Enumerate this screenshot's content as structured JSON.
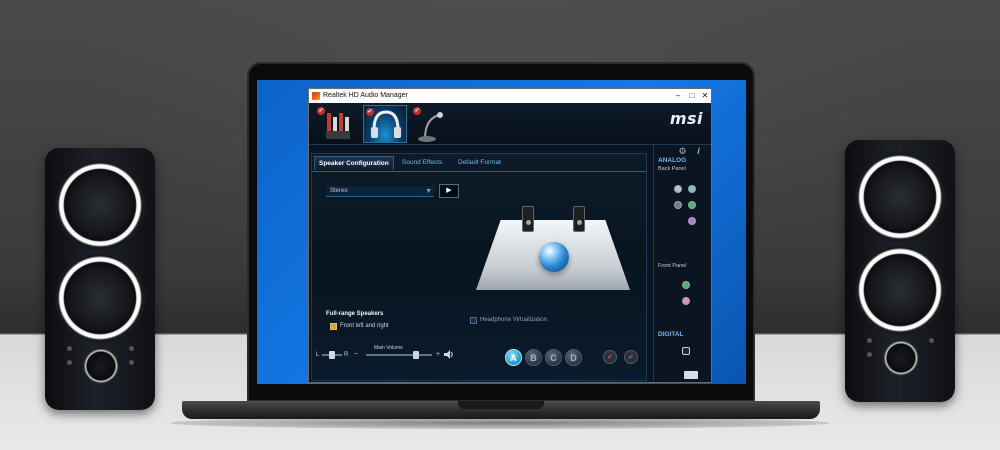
{
  "window": {
    "title": "Realtek HD Audio Manager",
    "minimize": "–",
    "maximize": "□",
    "close": "✕",
    "brand": "msi"
  },
  "tabs": [
    {
      "label": "Speaker Configuration",
      "active": true
    },
    {
      "label": "Sound Effects",
      "active": false
    },
    {
      "label": "Default Format",
      "active": false
    }
  ],
  "config": {
    "selected": "Stereo",
    "play_icon": "▶"
  },
  "fullrange": {
    "heading": "Full-range Speakers",
    "option": "Front left and right",
    "checked": true
  },
  "virtualization": {
    "label": "Headphone Virtualization",
    "checked": false
  },
  "volume": {
    "label": "Main Volume",
    "left": "L",
    "right": "R",
    "minus": "−",
    "plus": "+",
    "balance": 0.5,
    "level": 0.75
  },
  "profiles": [
    "A",
    "B",
    "C",
    "D"
  ],
  "side": {
    "analog": "ANALOG",
    "back_panel": "Back Panel",
    "front_panel": "Front Panel",
    "digital": "DIGITAL",
    "info_icon": "i"
  },
  "colors": {
    "accent": "#6cb7ee",
    "panel": "#0a1420",
    "screen": "#1478e6"
  }
}
